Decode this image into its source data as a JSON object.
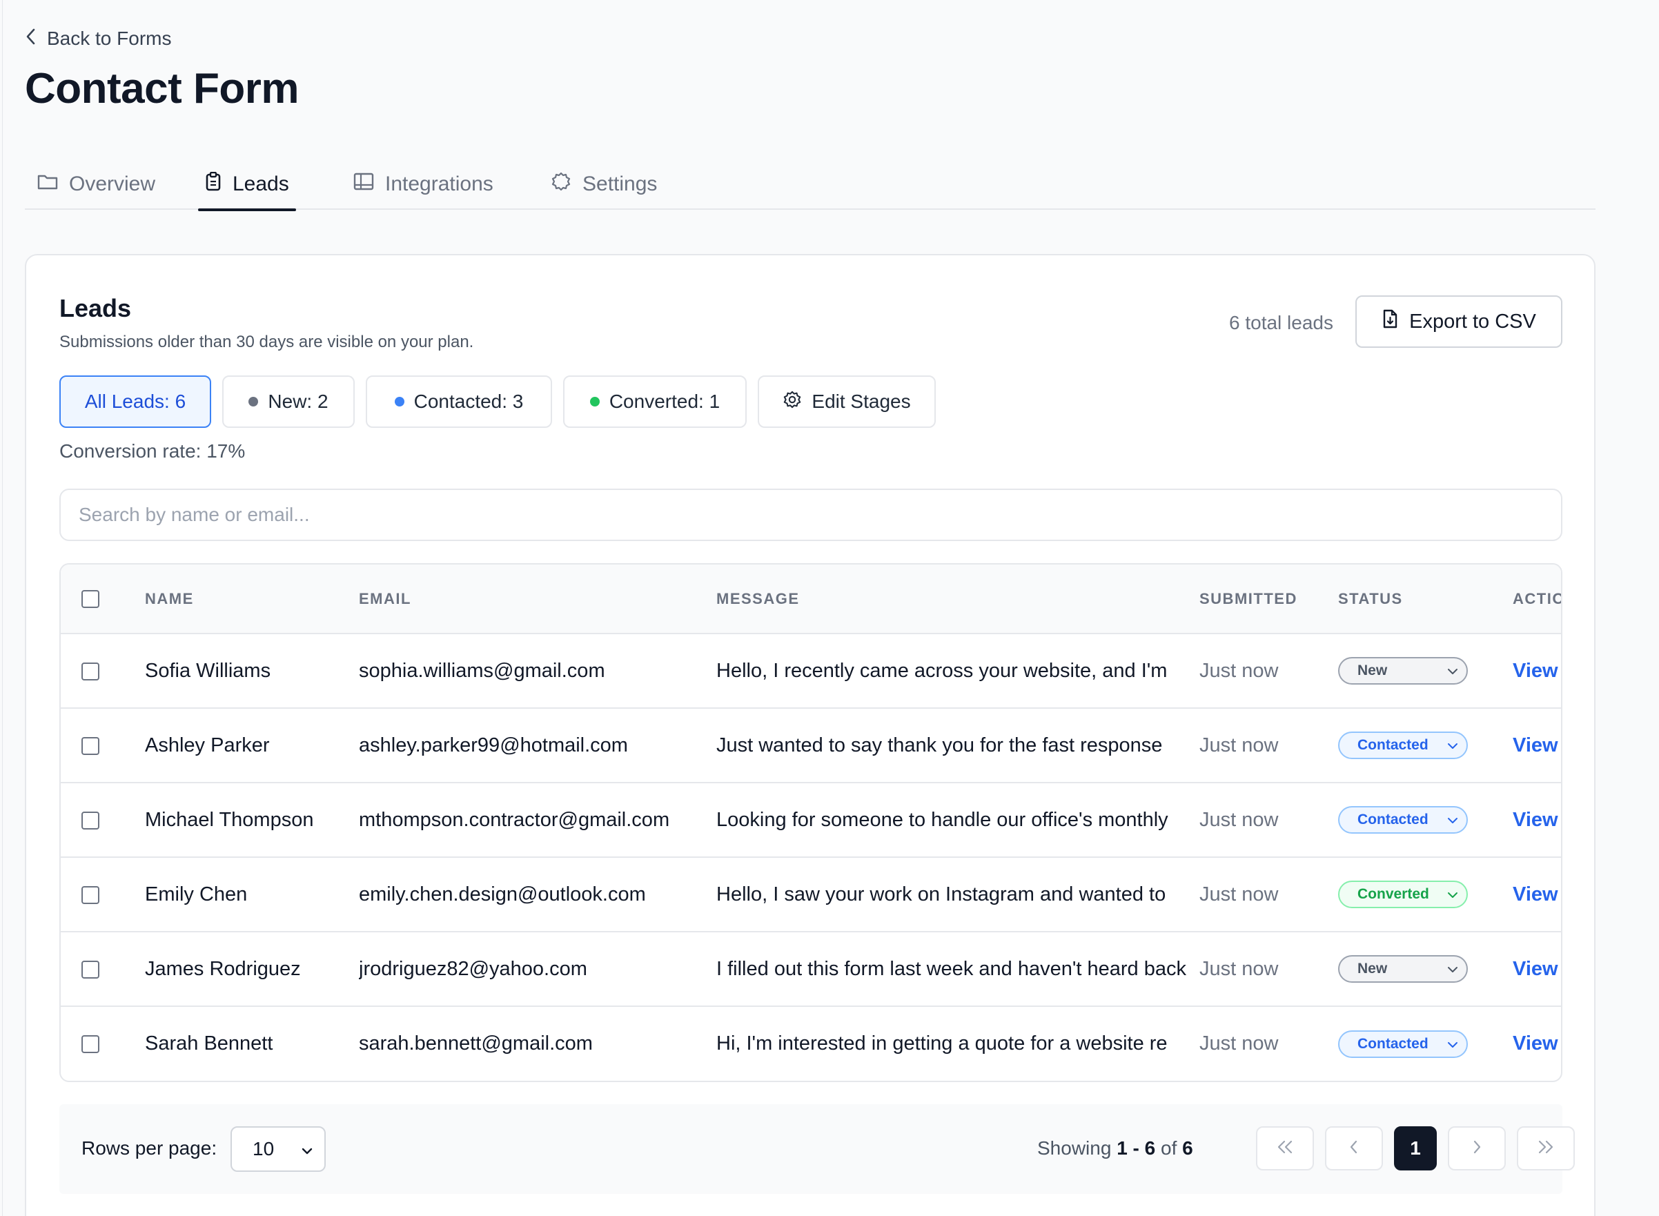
{
  "nav": {
    "back_label": "Back to Forms"
  },
  "page": {
    "title": "Contact Form"
  },
  "tabs": [
    {
      "label": "Overview",
      "icon": "folder-icon",
      "active": false
    },
    {
      "label": "Leads",
      "icon": "clipboard-icon",
      "active": true
    },
    {
      "label": "Integrations",
      "icon": "integrations-icon",
      "active": false
    },
    {
      "label": "Settings",
      "icon": "gear-icon",
      "active": false
    }
  ],
  "leads_card": {
    "title": "Leads",
    "subtitle": "Submissions older than 30 days are visible on your plan.",
    "total_label": "6 total leads",
    "export_label": "Export to CSV",
    "chips": {
      "all": "All Leads: 6",
      "new": "New: 2",
      "contacted": "Contacted: 3",
      "converted": "Converted: 1",
      "edit": "Edit Stages"
    },
    "conversion_rate": "Conversion rate: 17%",
    "search_placeholder": "Search by name or email..."
  },
  "table": {
    "headers": {
      "name": "NAME",
      "email": "EMAIL",
      "message": "MESSAGE",
      "submitted": "SUBMITTED",
      "status": "STATUS",
      "actions": "ACTIONS"
    },
    "view_label": "View",
    "rows": [
      {
        "name": "Sofia Williams",
        "email": "sophia.williams@gmail.com",
        "message": "Hello, I recently came across your website, and I'm",
        "submitted": "Just now",
        "status": "New",
        "status_kind": "new"
      },
      {
        "name": "Ashley Parker",
        "email": "ashley.parker99@hotmail.com",
        "message": "Just wanted to say thank you for the fast response",
        "submitted": "Just now",
        "status": "Contacted",
        "status_kind": "contacted"
      },
      {
        "name": "Michael Thompson",
        "email": "mthompson.contractor@gmail.com",
        "message": "Looking for someone to handle our office's monthly",
        "submitted": "Just now",
        "status": "Contacted",
        "status_kind": "contacted"
      },
      {
        "name": "Emily Chen",
        "email": "emily.chen.design@outlook.com",
        "message": "Hello, I saw your work on Instagram and wanted to",
        "submitted": "Just now",
        "status": "Converted",
        "status_kind": "converted"
      },
      {
        "name": "James Rodriguez",
        "email": "jrodriguez82@yahoo.com",
        "message": "I filled out this form last week and haven't heard back",
        "submitted": "Just now",
        "status": "New",
        "status_kind": "new"
      },
      {
        "name": "Sarah Bennett",
        "email": "sarah.bennett@gmail.com",
        "message": "Hi, I'm interested in getting a quote for a website re",
        "submitted": "Just now",
        "status": "Contacted",
        "status_kind": "contacted"
      }
    ]
  },
  "pagination": {
    "rows_per_page_label": "Rows per page:",
    "rows_per_page_value": "10",
    "showing_prefix": "Showing",
    "showing_range": "1 - 6",
    "showing_of": "of",
    "showing_total": "6",
    "current_page": "1"
  },
  "colors": {
    "accent": "#2563eb",
    "new_dot": "#6b7280",
    "contacted_dot": "#3b82f6",
    "converted_dot": "#22c55e"
  }
}
